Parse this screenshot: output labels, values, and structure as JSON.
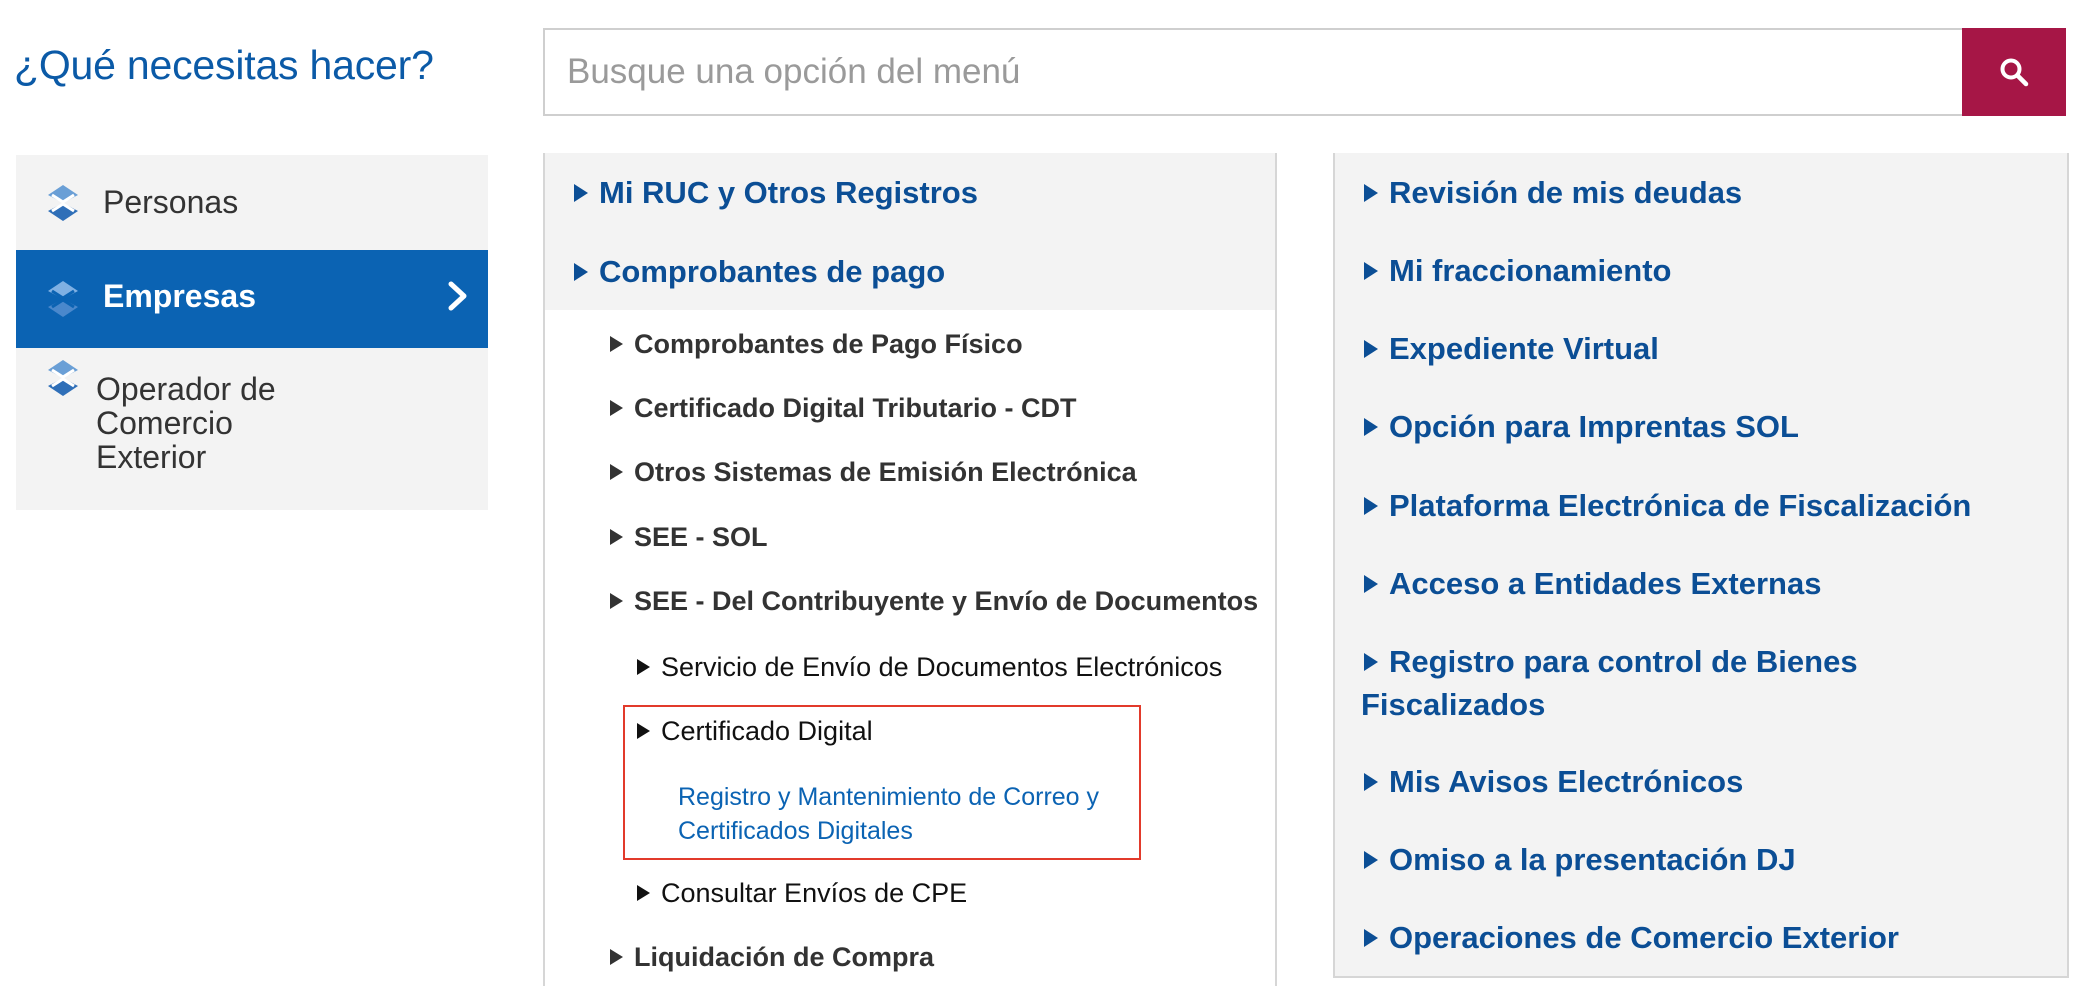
{
  "heading": "¿Qué necesitas hacer?",
  "search": {
    "placeholder": "Busque una opción del menú",
    "button_icon": "search-icon"
  },
  "categories": [
    {
      "label": "Personas",
      "active": false
    },
    {
      "label": "Empresas",
      "active": true
    },
    {
      "label": "Operador de Comercio Exterior",
      "active": false
    }
  ],
  "middle": {
    "items": [
      "Mi RUC y Otros Registros",
      "Comprobantes de pago"
    ],
    "sub_items": [
      "Comprobantes de Pago Físico",
      "Certificado Digital Tributario - CDT",
      "Otros Sistemas de Emisión Electrónica",
      "SEE - SOL",
      "SEE - Del Contribuyente y Envío de Documentos"
    ],
    "see_children": [
      "Servicio de Envío de Documentos Electrónicos",
      "Certificado Digital",
      "Consultar Envíos de CPE"
    ],
    "highlighted_link": "Registro y Mantenimiento de Correo y Certificados Digitales",
    "last_item": "Liquidación de Compra"
  },
  "right": {
    "items": [
      "Revisión de mis deudas",
      "Mi fraccionamiento",
      "Expediente Virtual",
      "Opción para Imprentas SOL",
      "Plataforma Electrónica de Fiscalización",
      "Acceso a Entidades Externas",
      "Registro para control de Bienes Fiscalizados",
      "Mis Avisos Electrónicos",
      "Omiso a la presentación DJ",
      "Operaciones de Comercio Exterior"
    ]
  },
  "colors": {
    "brand_blue": "#0b63b3",
    "link_blue": "#0b4e95",
    "search_button": "#a61646",
    "highlight_border": "#e23a2b"
  }
}
